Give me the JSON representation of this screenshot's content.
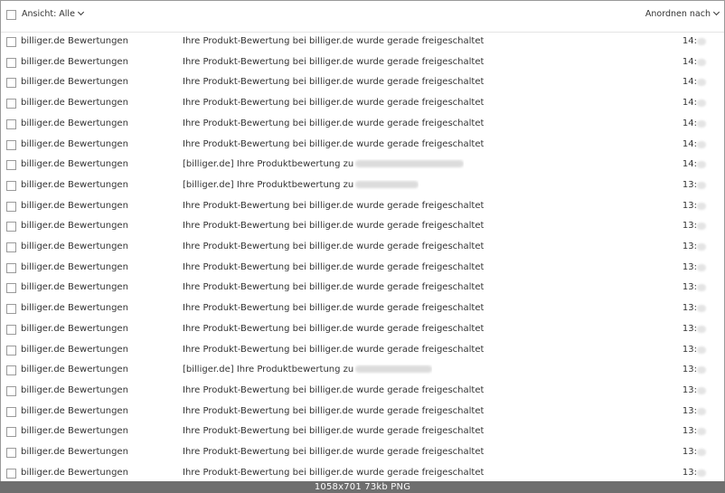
{
  "toolbar": {
    "view_filter_label": "Ansicht: Alle",
    "sort_label": "Anordnen nach"
  },
  "messages": [
    {
      "sender": "billiger.de Bewertungen",
      "subject": "Ihre Produkt-Bewertung bei billiger.de wurde gerade freigeschaltet",
      "time": "14:",
      "subject_redacted": false
    },
    {
      "sender": "billiger.de Bewertungen",
      "subject": "Ihre Produkt-Bewertung bei billiger.de wurde gerade freigeschaltet",
      "time": "14:",
      "subject_redacted": false
    },
    {
      "sender": "billiger.de Bewertungen",
      "subject": "Ihre Produkt-Bewertung bei billiger.de wurde gerade freigeschaltet",
      "time": "14:",
      "subject_redacted": false
    },
    {
      "sender": "billiger.de Bewertungen",
      "subject": "Ihre Produkt-Bewertung bei billiger.de wurde gerade freigeschaltet",
      "time": "14:",
      "subject_redacted": false
    },
    {
      "sender": "billiger.de Bewertungen",
      "subject": "Ihre Produkt-Bewertung bei billiger.de wurde gerade freigeschaltet",
      "time": "14:",
      "subject_redacted": false
    },
    {
      "sender": "billiger.de Bewertungen",
      "subject": "Ihre Produkt-Bewertung bei billiger.de wurde gerade freigeschaltet",
      "time": "14:",
      "subject_redacted": false
    },
    {
      "sender": "billiger.de Bewertungen",
      "subject": "[billiger.de] Ihre Produktbewertung zu",
      "time": "14:",
      "subject_redacted": true
    },
    {
      "sender": "billiger.de Bewertungen",
      "subject": "[billiger.de] Ihre Produktbewertung zu",
      "time": "13:",
      "subject_redacted": true
    },
    {
      "sender": "billiger.de Bewertungen",
      "subject": "Ihre Produkt-Bewertung bei billiger.de wurde gerade freigeschaltet",
      "time": "13:",
      "subject_redacted": false
    },
    {
      "sender": "billiger.de Bewertungen",
      "subject": "Ihre Produkt-Bewertung bei billiger.de wurde gerade freigeschaltet",
      "time": "13:",
      "subject_redacted": false
    },
    {
      "sender": "billiger.de Bewertungen",
      "subject": "Ihre Produkt-Bewertung bei billiger.de wurde gerade freigeschaltet",
      "time": "13:",
      "subject_redacted": false
    },
    {
      "sender": "billiger.de Bewertungen",
      "subject": "Ihre Produkt-Bewertung bei billiger.de wurde gerade freigeschaltet",
      "time": "13:",
      "subject_redacted": false
    },
    {
      "sender": "billiger.de Bewertungen",
      "subject": "Ihre Produkt-Bewertung bei billiger.de wurde gerade freigeschaltet",
      "time": "13:",
      "subject_redacted": false
    },
    {
      "sender": "billiger.de Bewertungen",
      "subject": "Ihre Produkt-Bewertung bei billiger.de wurde gerade freigeschaltet",
      "time": "13:",
      "subject_redacted": false
    },
    {
      "sender": "billiger.de Bewertungen",
      "subject": "Ihre Produkt-Bewertung bei billiger.de wurde gerade freigeschaltet",
      "time": "13:",
      "subject_redacted": false
    },
    {
      "sender": "billiger.de Bewertungen",
      "subject": "Ihre Produkt-Bewertung bei billiger.de wurde gerade freigeschaltet",
      "time": "13:",
      "subject_redacted": false
    },
    {
      "sender": "billiger.de Bewertungen",
      "subject": "[billiger.de] Ihre Produktbewertung zu",
      "time": "13:",
      "subject_redacted": true
    },
    {
      "sender": "billiger.de Bewertungen",
      "subject": "Ihre Produkt-Bewertung bei billiger.de wurde gerade freigeschaltet",
      "time": "13:",
      "subject_redacted": false
    },
    {
      "sender": "billiger.de Bewertungen",
      "subject": "Ihre Produkt-Bewertung bei billiger.de wurde gerade freigeschaltet",
      "time": "13:",
      "subject_redacted": false
    },
    {
      "sender": "billiger.de Bewertungen",
      "subject": "Ihre Produkt-Bewertung bei billiger.de wurde gerade freigeschaltet",
      "time": "13:",
      "subject_redacted": false
    },
    {
      "sender": "billiger.de Bewertungen",
      "subject": "Ihre Produkt-Bewertung bei billiger.de wurde gerade freigeschaltet",
      "time": "13:",
      "subject_redacted": false
    },
    {
      "sender": "billiger.de Bewertungen",
      "subject": "Ihre Produkt-Bewertung bei billiger.de wurde gerade freigeschaltet",
      "time": "13:",
      "subject_redacted": false
    }
  ],
  "status_bar": {
    "text": "1058x701  73kb  PNG"
  }
}
